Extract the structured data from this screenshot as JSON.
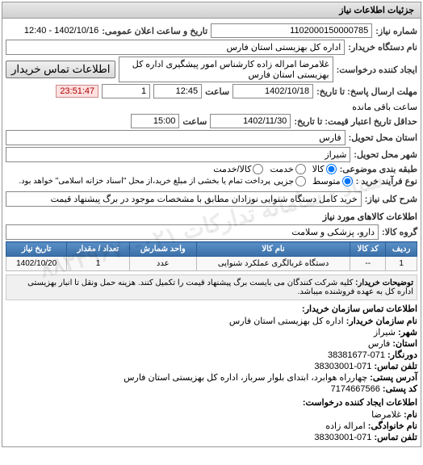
{
  "panel_title": "جزئیات اطلاعات نیاز",
  "header": {
    "request_number_label": "شماره نیاز:",
    "request_number": "1102000150000785",
    "public_datetime_label": "تاریخ و ساعت اعلان عمومی:",
    "public_datetime": "1402/10/16 - 12:40",
    "org_name_label": "نام دستگاه خریدار:",
    "org_name": "اداره کل بهزیستی استان فارس",
    "requester_label": "ایجاد کننده درخواست:",
    "requester": "غلامرضا امراله زاده کارشناس امور پیشگیری اداره کل بهزیستی استان فارس",
    "contact_btn": "اطلاعات تماس خریدار",
    "deadline_send_label": "مهلت ارسال پاسخ: تا تاریخ:",
    "deadline_send_date": "1402/10/18",
    "time_label": "ساعت",
    "deadline_send_time": "12:45",
    "day_count": "1",
    "timer": "23:51:47",
    "remaining_label": "ساعت باقی مانده",
    "validity_label": "حداقل تاریخ اعتبار قیمت: تا تاریخ:",
    "validity_date": "1402/11/30",
    "validity_time": "15:00",
    "province_label": "استان محل تحویل:",
    "province": "فارس",
    "city_label": "شهر محل تحویل:",
    "city": "شیراز",
    "packaging_label": "طبقه بندی موضوعی:",
    "packaging_options": [
      "کالا",
      "خدمت",
      "کالا/خدمت"
    ],
    "packaging_selected": "کالا",
    "purchase_type_label": "نوع فرآیند خرید :",
    "purchase_options": [
      "متوسط",
      "جزیی"
    ],
    "purchase_selected": "متوسط",
    "purchase_note": "پرداخت تمام یا بخشی از مبلغ خرید،از محل \"اسناد خزانه اسلامی\" خواهد بود."
  },
  "description": {
    "label": "شرح کلی نیاز:",
    "text": "خرید کامل دستگاه شنوایی نوزادان مطابق با مشخصات موجود در برگ پیشنهاد قیمت"
  },
  "goods_section": {
    "title": "اطلاعات کالاهای مورد نیاز",
    "group_label": "گروه کالا:",
    "group_value": "دارو، پزشکی و سلامت",
    "table_headers": [
      "ردیف",
      "کد کالا",
      "نام کالا",
      "واحد شمارش",
      "تعداد / مقدار",
      "تاریخ نیاز"
    ],
    "table_rows": [
      {
        "row": "1",
        "code": "--",
        "name": "دستگاه غربالگری عملکرد شنوایی",
        "unit": "عدد",
        "qty": "1",
        "date": "1402/10/20"
      }
    ],
    "note_label": "توضیحات خریدار:",
    "note_text": "کلیه شرکت کنندگان می بایست برگ پیشنهاد قیمت را تکمیل کنند. هزینه حمل ونقل تا انبار بهزیستی اداره کل به عهده فروشنده میباشد."
  },
  "contact": {
    "title": "اطلاعات تماس سازمان خریدار:",
    "org_label": "نام سازمان خریدار:",
    "org": "اداره کل بهزیستی استان فارس",
    "city_label": "شهر:",
    "city": "شیراز",
    "province_label": "استان:",
    "province": "فارس",
    "fax_label": "دورنگار:",
    "fax": "071-38381677",
    "phone_label": "تلفن تماس:",
    "phone": "071-38303001",
    "address_label": "آدرس پستی:",
    "address": "چهارراه هوابرد، ابتدای بلوار سرباز، اداره کل بهزیستی استان فارس",
    "postal_label": "کد پستی:",
    "postal": "7174667566",
    "requester_title": "اطلاعات ایجاد کننده درخواست:",
    "name_label": "نام:",
    "name": "غلامرضا",
    "family_label": "نام خانوادگی:",
    "family": "امراله زاده",
    "req_phone_label": "تلفن تماس:",
    "req_phone": "071-38303001"
  },
  "watermark": "ستاد - سامانه تدارکات ۰۲۱-۸۸۳۴۹۶۷۰"
}
